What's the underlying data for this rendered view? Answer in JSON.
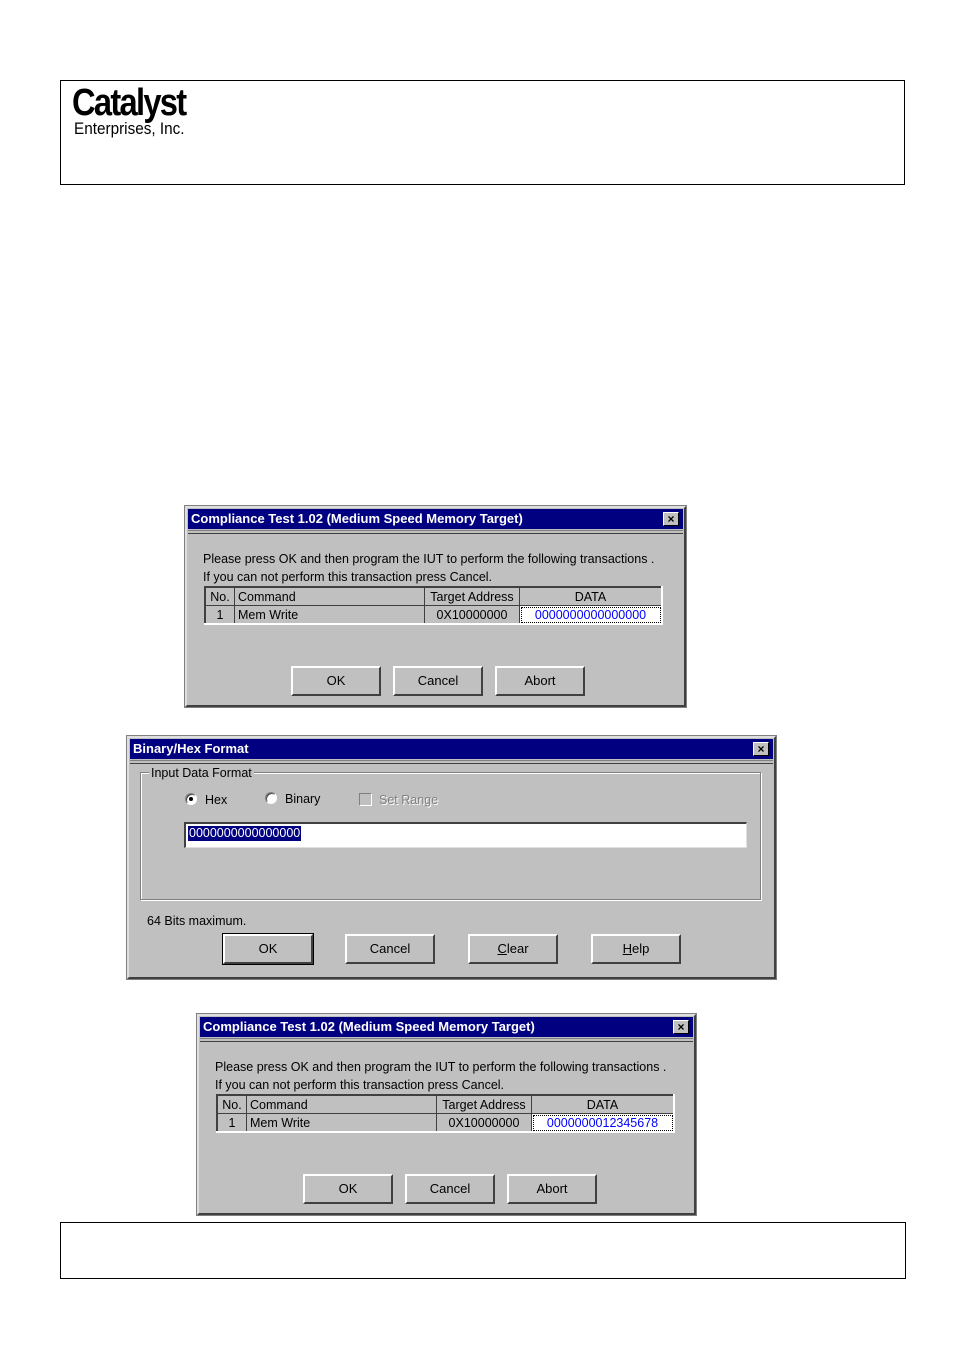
{
  "header": {
    "company_name": "Catalyst",
    "company_subtitle": "Enterprises, Inc."
  },
  "dialog1": {
    "title": "Compliance Test 1.02 (Medium Speed Memory Target)",
    "close_symbol": "×",
    "message_line1": "Please press OK and then program the IUT to perform the following transactions .",
    "message_line2": "If you can not perform this transaction press Cancel.",
    "table": {
      "headers": [
        "No.",
        "Command",
        "Target Address",
        "DATA"
      ],
      "rows": [
        {
          "no": "1",
          "command": "Mem Write",
          "target_address": "0X10000000",
          "data": "0000000000000000"
        }
      ]
    },
    "buttons": {
      "ok": "OK",
      "cancel": "Cancel",
      "abort": "Abort"
    }
  },
  "dialog2": {
    "title": "Binary/Hex Format",
    "close_symbol": "×",
    "group_label": "Input Data Format",
    "options": {
      "hex_label": "Hex",
      "hex_selected": true,
      "binary_label": "Binary",
      "binary_selected": false,
      "set_range_label": "Set Range",
      "set_range_checked": false,
      "set_range_enabled": false
    },
    "input_value": "0000000000000000",
    "note": "64 Bits maximum.",
    "buttons": {
      "ok": "OK",
      "cancel": "Cancel",
      "clear_prefix": "",
      "clear_accel": "C",
      "clear_rest": "lear",
      "help_accel": "H",
      "help_rest": "elp"
    }
  },
  "dialog3": {
    "title": "Compliance Test 1.02 (Medium Speed Memory Target)",
    "close_symbol": "×",
    "message_line1": "Please press OK and then program the IUT to perform the following transactions .",
    "message_line2": "If you can not perform this transaction press Cancel.",
    "table": {
      "headers": [
        "No.",
        "Command",
        "Target Address",
        "DATA"
      ],
      "rows": [
        {
          "no": "1",
          "command": "Mem Write",
          "target_address": "0X10000000",
          "data": "0000000012345678"
        }
      ]
    },
    "buttons": {
      "ok": "OK",
      "cancel": "Cancel",
      "abort": "Abort"
    }
  },
  "colors": {
    "titlebar": "#000080",
    "dialog_face": "#c0c0c0",
    "data_text": "#0000ff",
    "selection": "#000080"
  }
}
